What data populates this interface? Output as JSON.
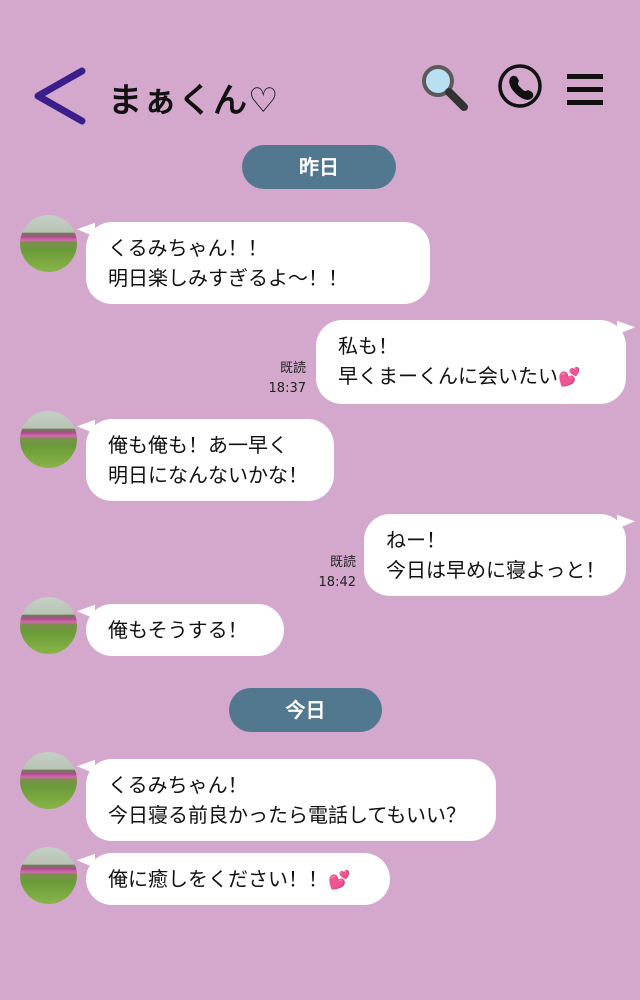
{
  "header": {
    "title": "まぁくん♡",
    "back_icon": "back-chevron-icon",
    "search_icon": "search-icon",
    "phone_icon": "phone-icon",
    "menu_icon": "menu-icon"
  },
  "dates": {
    "yesterday": "昨日",
    "today": "今日"
  },
  "messages": [
    {
      "from": "them",
      "lines": [
        "くるみちゃん！！",
        "明日楽しみすぎるよ〜！！"
      ]
    },
    {
      "from": "me",
      "lines": [
        "私も！",
        "早くまーくんに会いたい"
      ],
      "heart": "💕",
      "read": "既読",
      "time": "18:37"
    },
    {
      "from": "them",
      "lines": [
        "俺も俺も！あ一早く",
        "明日になんないかな！"
      ]
    },
    {
      "from": "me",
      "lines": [
        "ねー！",
        "今日は早めに寝よっと！"
      ],
      "read": "既読",
      "time": "18:42"
    },
    {
      "from": "them",
      "lines": [
        "俺もそうする！"
      ]
    },
    {
      "from": "them",
      "lines": [
        "くるみちゃん！",
        "今日寝る前良かったら電話してもいい？"
      ]
    },
    {
      "from": "them",
      "lines": [
        "俺に癒しをください！！"
      ],
      "heart": "💕"
    }
  ],
  "colors": {
    "background": "#d4a8cc",
    "date_pill": "#52788f",
    "bubble": "#ffffff",
    "back_arrow": "#3a1f8a"
  }
}
